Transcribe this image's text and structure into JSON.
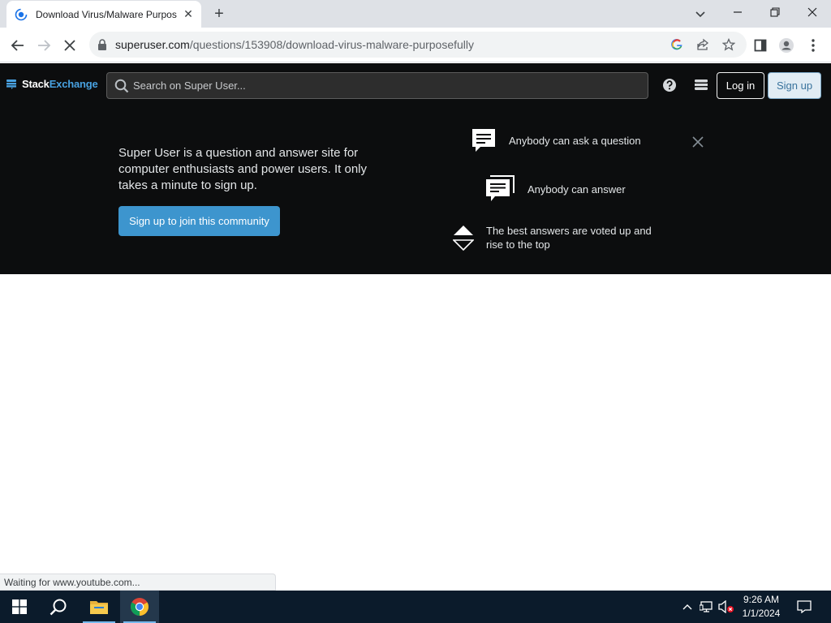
{
  "browser": {
    "tab_title": "Download Virus/Malware Purpos",
    "url_domain": "superuser.com",
    "url_path": "/questions/153908/download-virus-malware-purposefully",
    "status_text": "Waiting for www.youtube.com..."
  },
  "topbar": {
    "logo_stack": "Stack",
    "logo_exchange": "Exchange",
    "search_placeholder": "Search on Super User...",
    "login_label": "Log in",
    "signup_label": "Sign up"
  },
  "hero": {
    "description": "Super User is a question and answer site for computer enthusiasts and power users. It only takes a minute to sign up.",
    "cta_label": "Sign up to join this community",
    "features": [
      "Anybody can ask a question",
      "Anybody can answer",
      "The best answers are voted up and rise to the top"
    ]
  },
  "taskbar": {
    "time": "9:26 AM",
    "date": "1/1/2024"
  },
  "colors": {
    "se_dark": "#0c0d0e",
    "se_blue": "#3d95ce",
    "se_logo_blue": "#48a1e0",
    "taskbar": "#0b1b2b"
  }
}
